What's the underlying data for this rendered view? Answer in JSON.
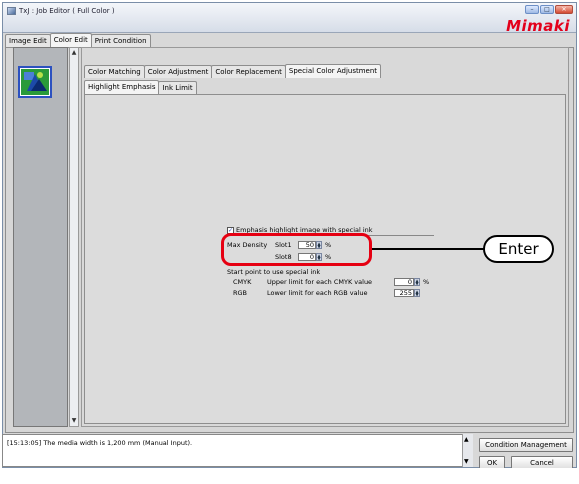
{
  "window": {
    "title": "TxJ : Job Editor ( Full Color )",
    "minimize_glyph": "–",
    "maximize_glyph": "□",
    "close_glyph": "✕",
    "brand": "Mimaki"
  },
  "tabs": {
    "top": [
      {
        "label": "Image Edit"
      },
      {
        "label": "Color Edit"
      },
      {
        "label": "Print Condition"
      }
    ],
    "second": [
      {
        "label": "Color Matching"
      },
      {
        "label": "Color Adjustment"
      },
      {
        "label": "Color Replacement"
      },
      {
        "label": "Special Color Adjustment"
      }
    ],
    "third": [
      {
        "label": "Highlight Emphasis"
      },
      {
        "label": "Ink Limit"
      }
    ]
  },
  "highlight": {
    "checkbox_label": "Emphasis highlight image with special ink",
    "checked_glyph": "✓",
    "max_density_label": "Max Density",
    "slot1_label": "Slot1",
    "slot1_value": "50",
    "slot8_label": "Slot8",
    "slot8_value": "0",
    "percent": "%",
    "start_point_label": "Start point to use special ink",
    "cmyk_label": "CMYK",
    "cmyk_desc": "Upper limit for each CMYK value",
    "cmyk_value": "0",
    "rgb_label": "RGB",
    "rgb_desc": "Lower limit for each RGB value",
    "rgb_value": "255"
  },
  "callout": {
    "label": "Enter"
  },
  "log": {
    "message": "[15:13:05] The media width is 1,200 mm (Manual Input)."
  },
  "buttons": {
    "condition_management": "Condition Management",
    "ok": "OK",
    "cancel": "Cancel"
  },
  "colors": {
    "accent_red": "#e60012",
    "brand_red": "#e3001b"
  }
}
